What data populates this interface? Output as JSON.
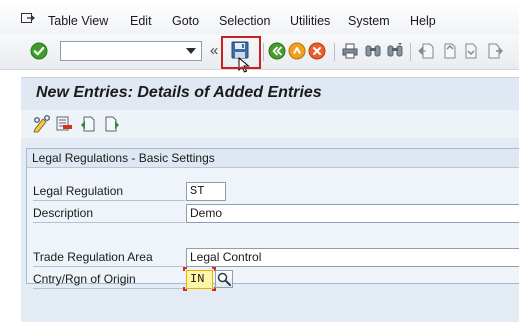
{
  "menubar": {
    "items": [
      "Table View",
      "Edit",
      "Goto",
      "Selection",
      "Utilities",
      "System",
      "Help"
    ],
    "menu_icon": "menu-exit-icon"
  },
  "toolbar": {
    "command_field": {
      "value": "",
      "placeholder": ""
    },
    "icons": [
      "enter-check-icon",
      "save-icon",
      "back-icon",
      "exit-icon",
      "cancel-icon",
      "print-icon",
      "find-icon",
      "find-next-icon",
      "first-page-icon",
      "previous-page-icon",
      "next-page-icon",
      "last-page-icon"
    ],
    "highlight_color": "#cc1f1f"
  },
  "title": "New Entries: Details of Added Entries",
  "app_toolbar": {
    "icons": [
      "display-change-icon",
      "delete-icon",
      "previous-entry-icon",
      "next-entry-icon"
    ]
  },
  "form": {
    "group_title": "Legal Regulations - Basic Settings",
    "fields": [
      {
        "label": "Legal Regulation",
        "value": "ST"
      },
      {
        "label": "Description",
        "value": "Demo"
      },
      {
        "label": "Trade Regulation Area",
        "value": "Legal Control"
      },
      {
        "label": "Cntry/Rgn of Origin",
        "value": "IN"
      }
    ]
  },
  "colors": {
    "title_bar": "#dfe8f3",
    "form_background": "#e3ecf5",
    "focused_field": "#fff6a8"
  }
}
